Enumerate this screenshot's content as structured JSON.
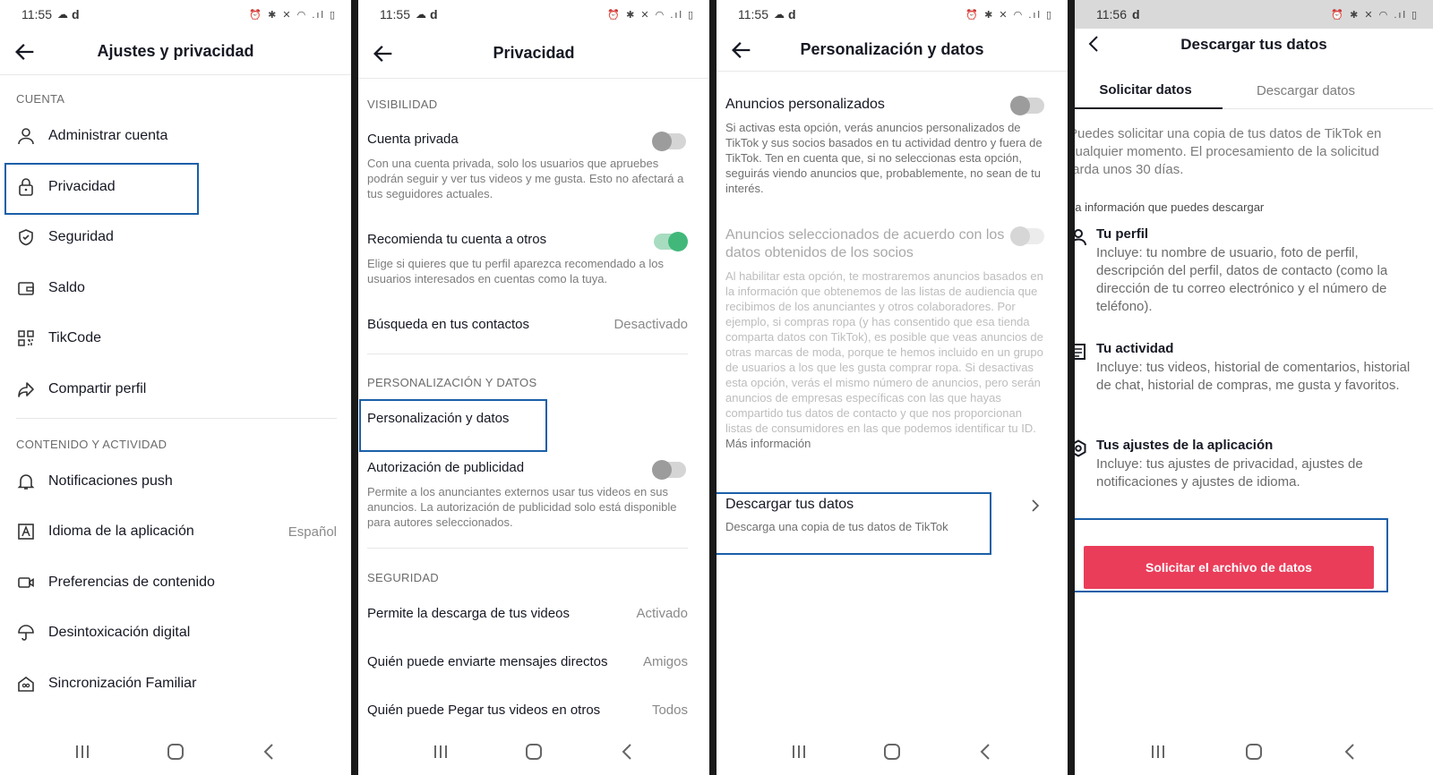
{
  "status": {
    "s1_time": "11:55",
    "s2_time": "11:55",
    "s3_time": "11:55",
    "s4_time": "11:56",
    "carrier": "d",
    "icons": "⏰ ✱ ✕ ◠ .ıl ▯"
  },
  "screen1": {
    "title": "Ajustes y privacidad",
    "section_account": "CUENTA",
    "account_items": [
      {
        "label": "Administrar cuenta",
        "icon": "person-icon"
      },
      {
        "label": "Privacidad",
        "icon": "lock-icon"
      },
      {
        "label": "Seguridad",
        "icon": "shield-icon"
      },
      {
        "label": "Saldo",
        "icon": "wallet-icon"
      },
      {
        "label": "TikCode",
        "icon": "qr-code-icon"
      },
      {
        "label": "Compartir perfil",
        "icon": "share-icon"
      }
    ],
    "section_content": "CONTENIDO Y ACTIVIDAD",
    "content_items": [
      {
        "label": "Notificaciones push",
        "icon": "bell-icon",
        "value": ""
      },
      {
        "label": "Idioma de la aplicación",
        "icon": "language-icon",
        "value": "Español"
      },
      {
        "label": "Preferencias de contenido",
        "icon": "video-icon",
        "value": ""
      },
      {
        "label": "Desintoxicación digital",
        "icon": "umbrella-icon",
        "value": ""
      },
      {
        "label": "Sincronización Familiar",
        "icon": "family-home-icon",
        "value": ""
      }
    ]
  },
  "screen2": {
    "title": "Privacidad",
    "section_visibility": "VISIBILIDAD",
    "private_account": {
      "title": "Cuenta privada",
      "desc": "Con una cuenta privada, solo los usuarios que apruebes podrán seguir y ver tus videos y me gusta. Esto no afectará a tus seguidores actuales.",
      "enabled": false
    },
    "recommend": {
      "title": "Recomienda tu cuenta a otros",
      "desc": "Elige si quieres que tu perfil aparezca recomendado a los usuarios interesados en cuentas como la tuya.",
      "enabled": true
    },
    "contacts_search": {
      "title": "Búsqueda en tus contactos",
      "value": "Desactivado"
    },
    "section_personalization": "PERSONALIZACIÓN Y DATOS",
    "personalization_item": "Personalización y datos",
    "ad_authorization": {
      "title": "Autorización de publicidad",
      "desc": "Permite a los anunciantes externos usar tus videos en sus anuncios. La autorización de publicidad solo está disponible para autores seleccionados.",
      "enabled": false
    },
    "section_security": "SEGURIDAD",
    "download_videos": {
      "title": "Permite la descarga de tus videos",
      "value": "Activado"
    },
    "direct_messages": {
      "title": "Quién puede enviarte mensajes directos",
      "value": "Amigos"
    },
    "paste_videos": {
      "title": "Quién puede Pegar tus videos en otros",
      "value": "Todos"
    }
  },
  "screen3": {
    "title": "Personalización y datos",
    "personalized_ads": {
      "title": "Anuncios personalizados",
      "desc": "Si activas esta opción, verás anuncios personalizados de TikTok y sus socios basados en tu actividad dentro y fuera de TikTok. Ten en cuenta que, si no seleccionas esta opción, seguirás viendo anuncios que, probablemente, no sean de tu interés.",
      "enabled": false
    },
    "partner_ads": {
      "title": "Anuncios seleccionados de acuerdo con los datos obtenidos de los socios",
      "desc": "Al habilitar esta opción, te mostraremos anuncios basados en la información que obtenemos de las listas de audiencia que recibimos de los anunciantes y otros colaboradores. Por ejemplo, si compras ropa (y has consentido que esa tienda comparta datos con TikTok), es posible que veas anuncios de otras marcas de moda, porque te hemos incluido en un grupo de usuarios a los que les gusta comprar ropa. Si desactivas esta opción, verás el mismo número de anuncios, pero serán anuncios de empresas específicas con las que hayas compartido tus datos de contacto y que nos proporcionan listas de consumidores en las que podemos identificar tu ID.",
      "more": "Más información",
      "enabled": false
    },
    "download": {
      "title": "Descargar tus datos",
      "desc": "Descarga una copia de tus datos de TikTok"
    }
  },
  "screen4": {
    "title": "Descargar tus datos",
    "tabs": [
      "Solicitar datos",
      "Descargar datos"
    ],
    "active_tab": "Solicitar datos",
    "intro": "Puedes solicitar una copia de tus datos de TikTok en cualquier momento. El procesamiento de la solicitud tarda unos 30 días.",
    "subtitle": "La información que puedes descargar",
    "items": [
      {
        "title": "Tu perfil",
        "desc": "Incluye: tu nombre de usuario, foto de perfil, descripción del perfil, datos de contacto (como la dirección de tu correo electrónico y el número de teléfono).",
        "icon": "person-icon"
      },
      {
        "title": "Tu actividad",
        "desc": "Incluye: tus videos, historial de comentarios, historial de chat, historial de compras, me gusta y favoritos.",
        "icon": "document-icon"
      },
      {
        "title": "Tus ajustes de la aplicación",
        "desc": "Incluye: tus ajustes de privacidad, ajustes de notificaciones y ajustes de idioma.",
        "icon": "settings-hex-icon"
      }
    ],
    "cta": "Solicitar el archivo de datos"
  },
  "colors": {
    "accent": "#ea3d5a",
    "highlight": "#1b5fa8",
    "toggle_on": "#41b87a"
  }
}
